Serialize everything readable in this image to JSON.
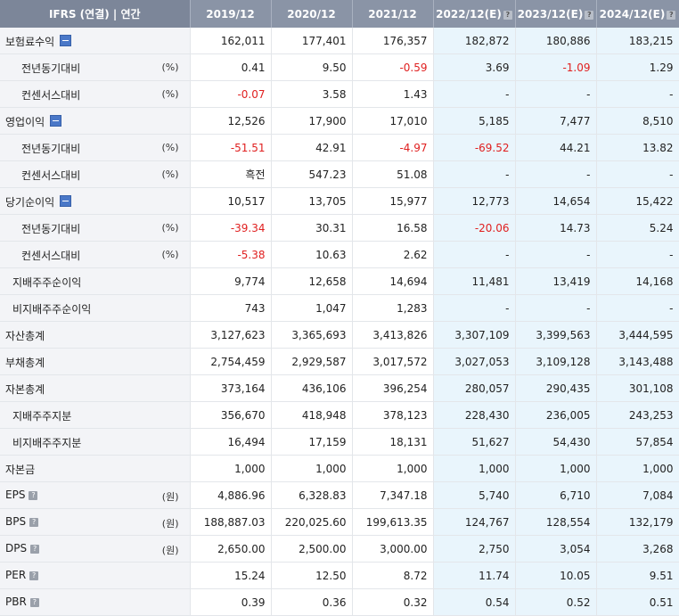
{
  "header": {
    "title": "IFRS (연결) | 연간",
    "periods": [
      "2019/12",
      "2020/12",
      "2021/12",
      "2022/12(E)",
      "2023/12(E)",
      "2024/12(E)"
    ],
    "estimate_flags": [
      false,
      false,
      false,
      true,
      true,
      true
    ],
    "help_glyph": "?"
  },
  "rows": [
    {
      "label": "보험료수익",
      "indent": 0,
      "unit": "",
      "toggle": true,
      "help": false,
      "values": [
        "162,011",
        "177,401",
        "176,357",
        "182,872",
        "180,886",
        "183,215"
      ]
    },
    {
      "label": "전년동기대비",
      "indent": 2,
      "unit": "(%)",
      "toggle": false,
      "help": false,
      "values": [
        "0.41",
        "9.50",
        "-0.59",
        "3.69",
        "-1.09",
        "1.29"
      ]
    },
    {
      "label": "컨센서스대비",
      "indent": 2,
      "unit": "(%)",
      "toggle": false,
      "help": false,
      "values": [
        "-0.07",
        "3.58",
        "1.43",
        "-",
        "-",
        "-"
      ]
    },
    {
      "label": "영업이익",
      "indent": 0,
      "unit": "",
      "toggle": true,
      "help": false,
      "values": [
        "12,526",
        "17,900",
        "17,010",
        "5,185",
        "7,477",
        "8,510"
      ]
    },
    {
      "label": "전년동기대비",
      "indent": 2,
      "unit": "(%)",
      "toggle": false,
      "help": false,
      "values": [
        "-51.51",
        "42.91",
        "-4.97",
        "-69.52",
        "44.21",
        "13.82"
      ]
    },
    {
      "label": "컨센서스대비",
      "indent": 2,
      "unit": "(%)",
      "toggle": false,
      "help": false,
      "values": [
        "흑전",
        "547.23",
        "51.08",
        "-",
        "-",
        "-"
      ]
    },
    {
      "label": "당기순이익",
      "indent": 0,
      "unit": "",
      "toggle": true,
      "help": false,
      "values": [
        "10,517",
        "13,705",
        "15,977",
        "12,773",
        "14,654",
        "15,422"
      ]
    },
    {
      "label": "전년동기대비",
      "indent": 2,
      "unit": "(%)",
      "toggle": false,
      "help": false,
      "values": [
        "-39.34",
        "30.31",
        "16.58",
        "-20.06",
        "14.73",
        "5.24"
      ]
    },
    {
      "label": "컨센서스대비",
      "indent": 2,
      "unit": "(%)",
      "toggle": false,
      "help": false,
      "values": [
        "-5.38",
        "10.63",
        "2.62",
        "-",
        "-",
        "-"
      ]
    },
    {
      "label": "지배주주순이익",
      "indent": 1,
      "unit": "",
      "toggle": false,
      "help": false,
      "values": [
        "9,774",
        "12,658",
        "14,694",
        "11,481",
        "13,419",
        "14,168"
      ]
    },
    {
      "label": "비지배주주순이익",
      "indent": 1,
      "unit": "",
      "toggle": false,
      "help": false,
      "values": [
        "743",
        "1,047",
        "1,283",
        "-",
        "-",
        "-"
      ]
    },
    {
      "label": "자산총계",
      "indent": 0,
      "unit": "",
      "toggle": false,
      "help": false,
      "values": [
        "3,127,623",
        "3,365,693",
        "3,413,826",
        "3,307,109",
        "3,399,563",
        "3,444,595"
      ]
    },
    {
      "label": "부채총계",
      "indent": 0,
      "unit": "",
      "toggle": false,
      "help": false,
      "values": [
        "2,754,459",
        "2,929,587",
        "3,017,572",
        "3,027,053",
        "3,109,128",
        "3,143,488"
      ]
    },
    {
      "label": "자본총계",
      "indent": 0,
      "unit": "",
      "toggle": false,
      "help": false,
      "values": [
        "373,164",
        "436,106",
        "396,254",
        "280,057",
        "290,435",
        "301,108"
      ]
    },
    {
      "label": "지배주주지분",
      "indent": 1,
      "unit": "",
      "toggle": false,
      "help": false,
      "values": [
        "356,670",
        "418,948",
        "378,123",
        "228,430",
        "236,005",
        "243,253"
      ]
    },
    {
      "label": "비지배주주지분",
      "indent": 1,
      "unit": "",
      "toggle": false,
      "help": false,
      "values": [
        "16,494",
        "17,159",
        "18,131",
        "51,627",
        "54,430",
        "57,854"
      ]
    },
    {
      "label": "자본금",
      "indent": 0,
      "unit": "",
      "toggle": false,
      "help": false,
      "values": [
        "1,000",
        "1,000",
        "1,000",
        "1,000",
        "1,000",
        "1,000"
      ]
    },
    {
      "label": "EPS",
      "indent": 0,
      "unit": "(원)",
      "toggle": false,
      "help": true,
      "values": [
        "4,886.96",
        "6,328.83",
        "7,347.18",
        "5,740",
        "6,710",
        "7,084"
      ]
    },
    {
      "label": "BPS",
      "indent": 0,
      "unit": "(원)",
      "toggle": false,
      "help": true,
      "values": [
        "188,887.03",
        "220,025.60",
        "199,613.35",
        "124,767",
        "128,554",
        "132,179"
      ]
    },
    {
      "label": "DPS",
      "indent": 0,
      "unit": "(원)",
      "toggle": false,
      "help": true,
      "values": [
        "2,650.00",
        "2,500.00",
        "3,000.00",
        "2,750",
        "3,054",
        "3,268"
      ]
    },
    {
      "label": "PER",
      "indent": 0,
      "unit": "",
      "toggle": false,
      "help": true,
      "values": [
        "15.24",
        "12.50",
        "8.72",
        "11.74",
        "10.05",
        "9.51"
      ]
    },
    {
      "label": "PBR",
      "indent": 0,
      "unit": "",
      "toggle": false,
      "help": true,
      "values": [
        "0.39",
        "0.36",
        "0.32",
        "0.54",
        "0.52",
        "0.51"
      ]
    }
  ],
  "colors": {
    "header_bg": "#8a94a6",
    "label_bg": "#f3f4f7",
    "estimate_bg": "#e9f5fc",
    "negative": "#e02020",
    "toggle": "#4a78c8"
  }
}
